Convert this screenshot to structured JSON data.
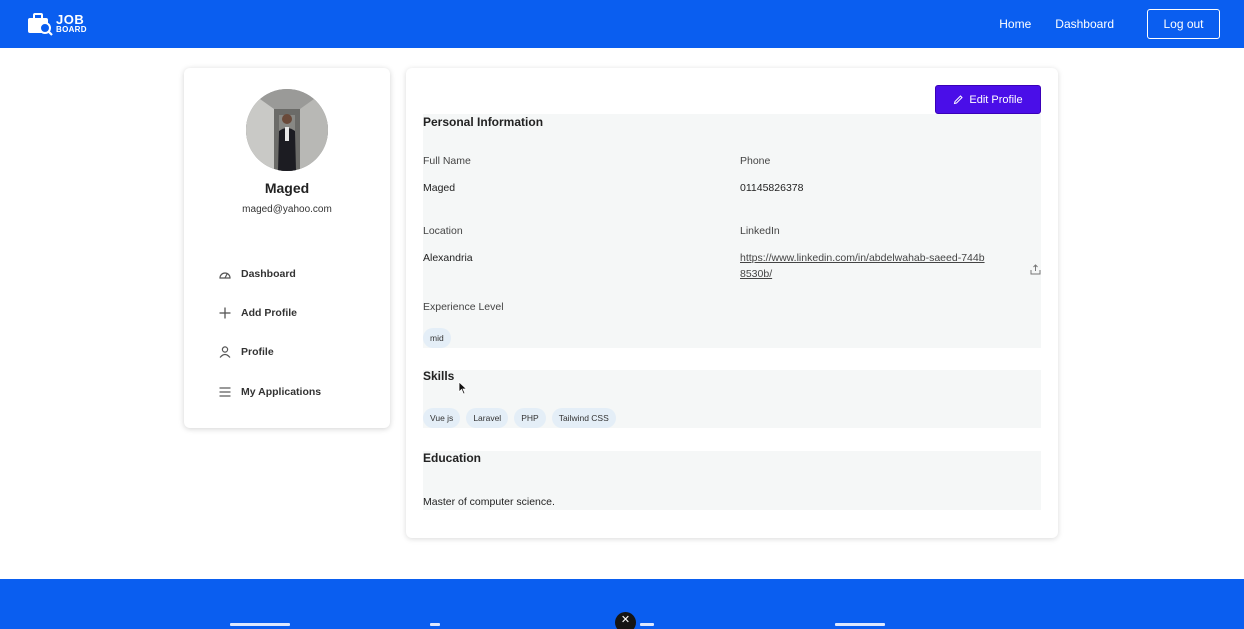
{
  "brand": {
    "line1": "JOB",
    "line2": "BOARD"
  },
  "nav": {
    "home": "Home",
    "dashboard": "Dashboard",
    "logout": "Log out"
  },
  "profile": {
    "name": "Maged",
    "email": "maged@yahoo.com"
  },
  "sidebar": {
    "items": [
      {
        "label": "Dashboard",
        "icon": "dashboard-icon"
      },
      {
        "label": "Add Profile",
        "icon": "plus-icon"
      },
      {
        "label": "Profile",
        "icon": "user-icon"
      },
      {
        "label": "My Applications",
        "icon": "list-icon"
      }
    ]
  },
  "main": {
    "edit_label": "Edit Profile",
    "personal": {
      "title": "Personal Information",
      "full_name_label": "Full Name",
      "full_name": "Maged",
      "phone_label": "Phone",
      "phone": "01145826378",
      "location_label": "Location",
      "location": "Alexandria",
      "linkedin_label": "LinkedIn",
      "linkedin": "https://www.linkedin.com/in/abdelwahab-saeed-744b8530b/",
      "experience_label": "Experience Level",
      "experience": "mid"
    },
    "skills": {
      "title": "Skills",
      "items": [
        "Vue js",
        "Laravel",
        "PHP",
        "Tailwind CSS"
      ]
    },
    "education": {
      "title": "Education",
      "value": "Master of computer science."
    }
  },
  "colors": {
    "primary": "#0a5ef0",
    "accent": "#4a0ee8",
    "pill": "#e4eef7",
    "section_bg": "#f5f7f7"
  }
}
